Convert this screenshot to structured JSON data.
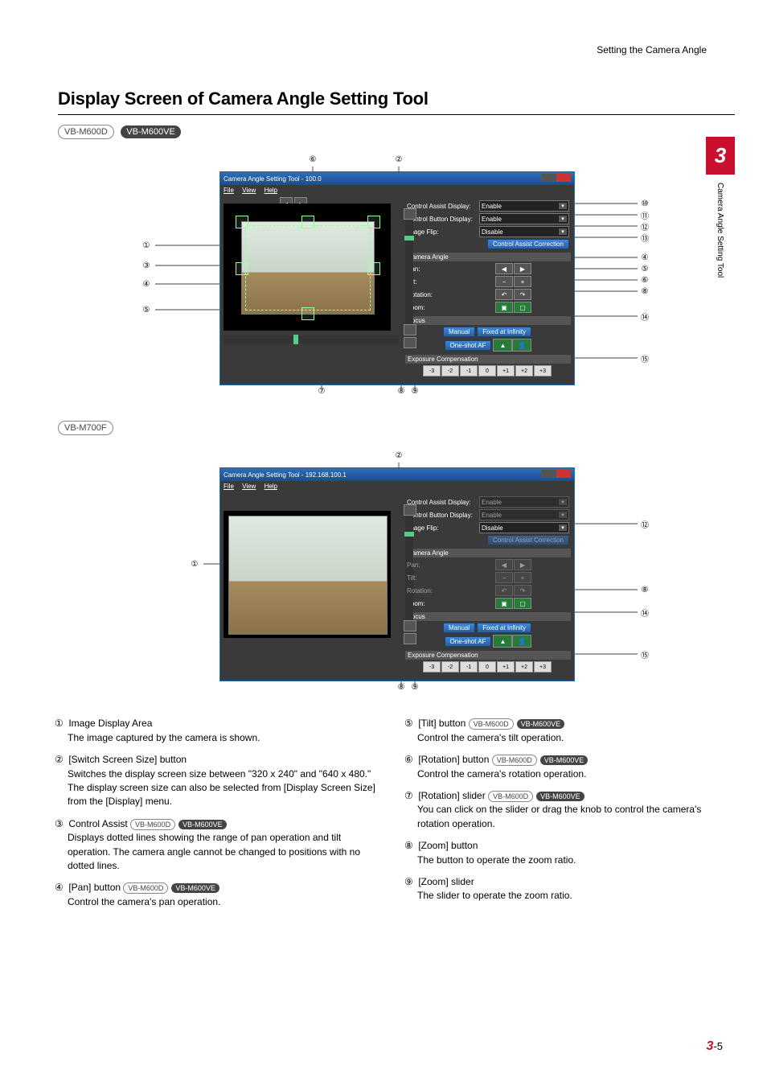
{
  "header": {
    "breadcrumb": "Setting the Camera Angle"
  },
  "section_title": "Display Screen of Camera Angle Setting Tool",
  "side_tab": {
    "chapter_num": "3",
    "vtext": "Camera Angle Setting Tool"
  },
  "models": {
    "m600d": "VB-M600D",
    "m600ve": "VB-M600VE",
    "m700f": "VB-M700F"
  },
  "window": {
    "title1": "Camera Angle Setting Tool - 100.0",
    "title2": "Camera Angle Setting Tool - 192.168.100.1",
    "menu": {
      "file": "File",
      "view": "View",
      "help": "Help"
    },
    "labels": {
      "cad": "Control Assist Display:",
      "cbd": "Control Button Display:",
      "flip": "Image Flip:",
      "cac_btn": "Control Assist Correction",
      "angle_head": "Camera Angle",
      "pan": "Pan:",
      "tilt": "Tilt:",
      "rot": "Rotation:",
      "zoom": "Zoom:",
      "focus_head": "Focus",
      "manual": "Manual",
      "fixed": "Fixed at Infinity",
      "oneshot": "One-shot AF",
      "exp_head": "Exposure Compensation",
      "enable": "Enable",
      "disable": "Disable"
    },
    "exp_values": [
      "-3",
      "-2",
      "-1",
      "0",
      "+1",
      "+2",
      "+3"
    ]
  },
  "callouts_top_fig1": [
    "⑥",
    "②"
  ],
  "callouts_top_fig2": [
    "②"
  ],
  "callouts_bottom_fig1": [
    "⑦",
    "⑧",
    "⑨"
  ],
  "callouts_bottom_fig2": [
    "⑧",
    "⑨"
  ],
  "callouts_left_fig1": [
    "①",
    "③",
    "④",
    "⑤"
  ],
  "callouts_left_fig2": [
    "①"
  ],
  "callouts_right_fig1": [
    "⑩",
    "⑪",
    "⑫",
    "⑬",
    "④",
    "⑤",
    "⑥",
    "⑧",
    "⑭",
    "⑮"
  ],
  "callouts_right_fig2": [
    "⑫",
    "⑧",
    "⑭",
    "⑮"
  ],
  "desc_left": [
    {
      "num": "①",
      "title": "Image Display Area",
      "body": "The image captured by the camera is shown.",
      "models": []
    },
    {
      "num": "②",
      "title": "[Switch Screen Size] button",
      "body": "Switches the display screen size between \"320 x 240\" and \"640 x 480.\" The display screen size can also be selected from [Display Screen Size] from the [Display] menu.",
      "models": []
    },
    {
      "num": "③",
      "title": "Control Assist",
      "body": "Displays dotted lines showing the range of pan operation and tilt operation. The camera angle cannot be changed to positions with no dotted lines.",
      "models": [
        "m600d",
        "m600ve"
      ]
    },
    {
      "num": "④",
      "title": "[Pan] button",
      "body": "Control the camera's pan operation.",
      "models": [
        "m600d",
        "m600ve"
      ]
    }
  ],
  "desc_right": [
    {
      "num": "⑤",
      "title": "[Tilt] button",
      "body": "Control the camera's tilt operation.",
      "models": [
        "m600d",
        "m600ve"
      ]
    },
    {
      "num": "⑥",
      "title": "[Rotation] button",
      "body": "Control the camera's rotation operation.",
      "models": [
        "m600d",
        "m600ve"
      ]
    },
    {
      "num": "⑦",
      "title": "[Rotation] slider",
      "body": "You can click on the slider or drag the knob to control the camera's rotation operation.",
      "models": [
        "m600d",
        "m600ve"
      ]
    },
    {
      "num": "⑧",
      "title": "[Zoom] button",
      "body": "The button to operate the zoom ratio.",
      "models": []
    },
    {
      "num": "⑨",
      "title": "[Zoom] slider",
      "body": "The slider to operate the zoom ratio.",
      "models": []
    }
  ],
  "footer": {
    "chapter": "3",
    "page": "-5"
  }
}
